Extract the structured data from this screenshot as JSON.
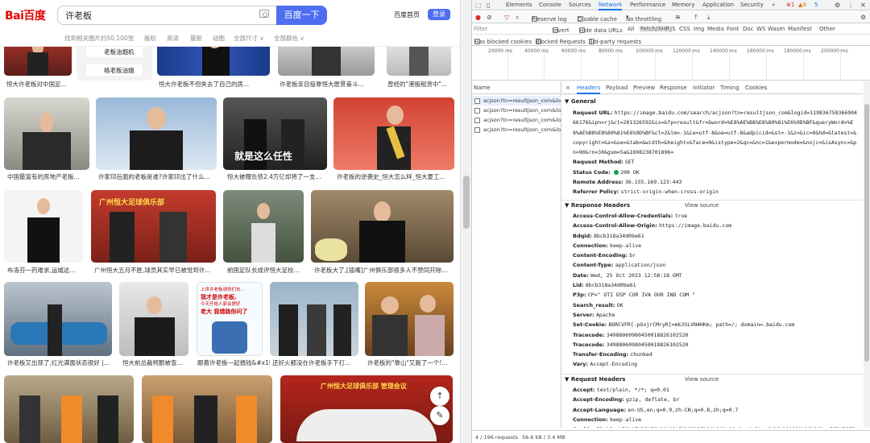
{
  "search": {
    "logo": "Bai百度",
    "query": "许老板",
    "button": "百度一下",
    "home_link": "百度首页",
    "login": "登录"
  },
  "filters": {
    "count": "找到相关图片约50,100张",
    "items": [
      "版权",
      "高清",
      "最新",
      "动图",
      "全部尺寸 ∨",
      "全部颜色 ∨"
    ]
  },
  "related_tags": [
    "老板油烟机",
    "格老板油烟"
  ],
  "captions": [
    "恒大许老板对中国足...",
    "恒大许老板不但失去了自己的房...",
    "许老板亲自投靠恒大愿景奋斗...",
    "曾经的\"港股租赁中\"...",
    "中国最富有的房地产老板...",
    "许家印后面的老板是谁?许家印出了什么...",
    "恒大被曝负债2.4万亿却将了一支...",
    "许老板的逆袭史_恒大怎么样_恒大夏工...",
    "布洛芬一药难求,运城这...",
    "广州恒大五月不胜,球员其实早已被觉到许...",
    "前国足队长成评恒大足校...",
    "许老板大了,[插嘴]广州俱乐部很多人不赞同开除...",
    "许老板又出现了,红光满面状态很好 |...",
    "恒大前总裁柯鹏被查...",
    "跟着许老板一起捐钱&#x1F4B0;",
    "还好火都没在许老板手下打...",
    "许老板的\"靠山\"又跑了一个!..."
  ],
  "overlay_text": "就是这么任性",
  "poster_text": [
    "上世许老板请你们去...",
    "我才是许老板,",
    "今天开始人家会更好",
    "老大 我错路你问了"
  ],
  "banner_text": [
    "广州恒大足球俱乐部",
    "广州恒大足球俱乐部 管理会议"
  ],
  "devtools": {
    "tabs": [
      "Elements",
      "Console",
      "Sources",
      "Network",
      "Performance",
      "Memory",
      "Application",
      "Security",
      "»"
    ],
    "badges": [
      "⊗1",
      "▲4",
      "5"
    ],
    "toolbar": [
      "Preserve log",
      "Disable cache",
      "No throttling"
    ],
    "filter_placeholder": "Filter",
    "filter_types": [
      "Invert",
      "Hide data URLs",
      "All",
      "Fetch/XHR",
      "JS",
      "CSS",
      "Img",
      "Media",
      "Font",
      "Doc",
      "WS",
      "Wasm",
      "Manifest",
      "Other"
    ],
    "filter2": [
      "Has blocked cookies",
      "Blocked Requests",
      "3rd-party requests"
    ],
    "timeline": [
      "20000 ms",
      "40000 ms",
      "60000 ms",
      "80000 ms",
      "100000 ms",
      "120000 ms",
      "140000 ms",
      "160000 ms",
      "180000 ms",
      "200000 ms"
    ],
    "name_header": "Name",
    "requests": [
      "acjson?tn=resultjson_com&lo...",
      "acjson?tn=resultjson_com&lo...",
      "acjson?tn=resultjson_com&lo...",
      "acjson?tn=resultjson_com&lo..."
    ],
    "detail_tabs": [
      "×",
      "Headers",
      "Payload",
      "Preview",
      "Response",
      "Initiator",
      "Timing",
      "Cookies"
    ],
    "general_title": "▼ General",
    "general": [
      [
        "Request URL: ",
        "https://image.baidu.com/search/acjson?tn=resultjson_com&logid=11983675836690466176&ipn=rj&ct=201326592&is=&fp=result&fr=&word=%E8%AE%B8%E8%80%81%E6%9D%BF&queryWord=%E8%AE%B8%E8%80%81%E6%9D%BF&cl=2&lm=-1&ie=utf-8&oe=utf-8&adpicid=&st=-1&z=&ic=0&hd=&latest=&copyright=&s=&se=&tab=&width=&height=&face=0&istype=2&qc=&nc=1&expermode=&nojc=&isAsync=&pn=90&rn=30&gsm=5a&1698238701896="
      ],
      [
        "Request Method: ",
        "GET"
      ],
      [
        "Status Code: ",
        "200 OK"
      ],
      [
        "Remote Address: ",
        "36.155.169.123:443"
      ],
      [
        "Referrer Policy: ",
        "strict-origin-when-cross-origin"
      ]
    ],
    "response_title": "▼ Response Headers",
    "request_title": "▼ Request Headers",
    "view_source": "View source",
    "response_headers": [
      [
        "Access-Control-Allow-Credentials: ",
        "true"
      ],
      [
        "Access-Control-Allow-Origin: ",
        "https://image.baidu.com"
      ],
      [
        "Bdqid: ",
        "8bcb318a34d0be61"
      ],
      [
        "Connection: ",
        "keep-alive"
      ],
      [
        "Content-Encoding: ",
        "br"
      ],
      [
        "Content-Type: ",
        "application/json"
      ],
      [
        "Date: ",
        "Wed, 25 Oct 2023 12:58:18 GMT"
      ],
      [
        "Lid: ",
        "8bcb318a34d0be61"
      ],
      [
        "P3p: ",
        "CP=\" OTI DSP COR IVA OUR IND COM \""
      ],
      [
        "Search_result: ",
        "OK"
      ],
      [
        "Server: ",
        "Apache"
      ],
      [
        "Set-Cookie: ",
        "BDRCVFR[-pGxjrCMryR]=mk3SLVN4HKm; path=/; domain=.baidu.com"
      ],
      [
        "Tracecode: ",
        "34988060980450018826102520"
      ],
      [
        "Tracecode: ",
        "34988060980450018826102520"
      ],
      [
        "Transfer-Encoding: ",
        "chunked"
      ],
      [
        "Vary: ",
        "Accept-Encoding"
      ]
    ],
    "request_headers": [
      [
        "Accept: ",
        "text/plain, */*; q=0.01"
      ],
      [
        "Accept-Encoding: ",
        "gzip, deflate, br"
      ],
      [
        "Accept-Language: ",
        "en-US,en;q=0.9,zh-CN;q=0.8,zh;q=0.7"
      ],
      [
        "Connection: ",
        "keep-alive"
      ],
      [
        "Cookie: ",
        "BDqhfp=%E8%AE%B8%E8%80%81%E6%9D%BF%26%260-10-1undefined%26%261620%26%262; BIDUPSID=49709FAC25AC8B395229D458C5A44051; PSTM=1684376127; BAIDUID=49709FAC25ACBB3969D1AEB538C47EC8:FG=1; H_WI"
      ]
    ],
    "status": [
      "4 / 196 requests",
      "56.6 kB / 3.4 MB"
    ]
  }
}
